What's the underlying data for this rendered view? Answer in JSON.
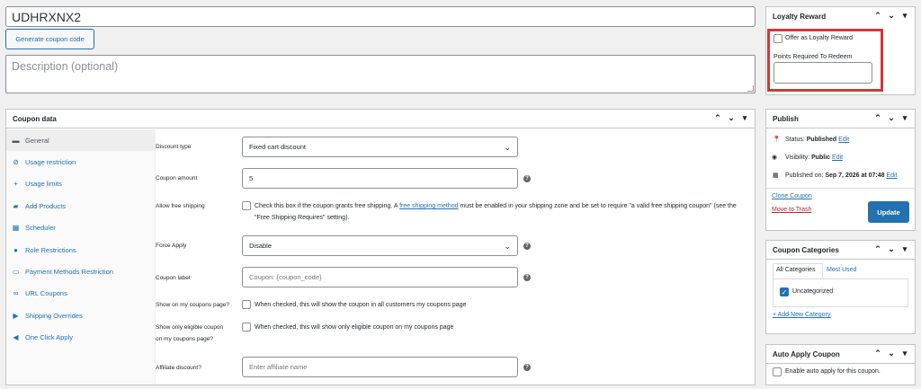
{
  "coupon_code": "UDHRXNX2",
  "generate_button": "Generate coupon code",
  "description_placeholder": "Description (optional)",
  "coupon_data": {
    "title": "Coupon data",
    "tabs": [
      {
        "label": "General",
        "icon": "ticket-icon"
      },
      {
        "label": "Usage restriction",
        "icon": "block-icon"
      },
      {
        "label": "Usage limits",
        "icon": "plus-icon"
      },
      {
        "label": "Add Products",
        "icon": "cart-icon"
      },
      {
        "label": "Scheduler",
        "icon": "calendar-icon"
      },
      {
        "label": "Role Restrictions",
        "icon": "person-icon"
      },
      {
        "label": "Payment Methods Restriction",
        "icon": "card-icon"
      },
      {
        "label": "URL Coupons",
        "icon": "link-icon"
      },
      {
        "label": "Shipping Overrides",
        "icon": "truck-icon"
      },
      {
        "label": "One Click Apply",
        "icon": "megaphone-icon"
      }
    ],
    "fields": {
      "discount_type_label": "Discount type",
      "discount_type_value": "Fixed cart discount",
      "coupon_amount_label": "Coupon amount",
      "coupon_amount_value": "5",
      "free_shipping_label": "Allow free shipping",
      "free_shipping_text_before": "Check this box if the coupon grants free shipping. A ",
      "free_shipping_link": "free shipping method",
      "free_shipping_text_after": " must be enabled in your shipping zone and be set to require \"a valid free shipping coupon\" (see the \"Free Shipping Requires\" setting).",
      "force_apply_label": "Force Apply",
      "force_apply_value": "Disable",
      "coupon_label_label": "Coupon label",
      "coupon_label_placeholder": "Coupon: {coupon_code}",
      "show_on_page_label": "Show on my coupons page?",
      "show_on_page_text": "When checked, this will show the coupon in all customers my coupons page",
      "show_eligible_label_1": "Show only eligible coupon",
      "show_eligible_label_2": "on my coupons page?",
      "show_eligible_text": "When checked, this will show only eligible coupon on my coupons page",
      "affiliate_label": "Affiliate discount?",
      "affiliate_placeholder": "Enter affiliate name"
    }
  },
  "loyalty": {
    "title": "Loyalty Reward",
    "offer_label": "Offer as Loyalty Reward",
    "points_label": "Points Required To Redeem",
    "highlight_color": "#d63638"
  },
  "publish": {
    "title": "Publish",
    "status_label": "Status:",
    "status_value": "Published",
    "visibility_label": "Visibility:",
    "visibility_value": "Public",
    "published_label": "Published on:",
    "published_value": "Sep 7, 2026 at 07:48",
    "edit": "Edit",
    "clone": "Clone Coupon",
    "trash": "Move to Trash",
    "update": "Update"
  },
  "categories": {
    "title": "Coupon Categories",
    "tab_all": "All Categories",
    "tab_most": "Most Used",
    "item": "Uncategorized",
    "add_new": "+ Add New Category"
  },
  "auto_apply": {
    "title": "Auto Apply Coupon",
    "label": "Enable auto apply for this coupon."
  }
}
